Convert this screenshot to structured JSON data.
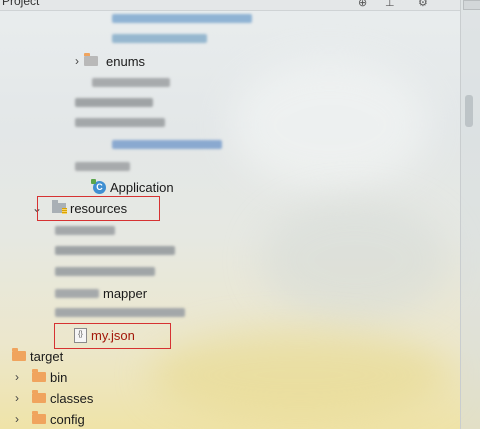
{
  "panel": {
    "title": "Project"
  },
  "tree": {
    "enums_label": "enums",
    "application_label": "Application",
    "resources_label": "resources",
    "mapper_label": "mapper",
    "json_file_label": "my.json",
    "target_label": "target",
    "target_children": [
      {
        "label": "bin"
      },
      {
        "label": "classes"
      },
      {
        "label": "config"
      }
    ]
  },
  "colors": {
    "folder": "#f0a45e",
    "highlight_box": "#d63232",
    "json_text": "#a3180a"
  },
  "icons": {
    "class": "java-class-icon",
    "folder": "folder-icon",
    "resources": "resources-folder-icon",
    "json": "json-file-icon"
  }
}
